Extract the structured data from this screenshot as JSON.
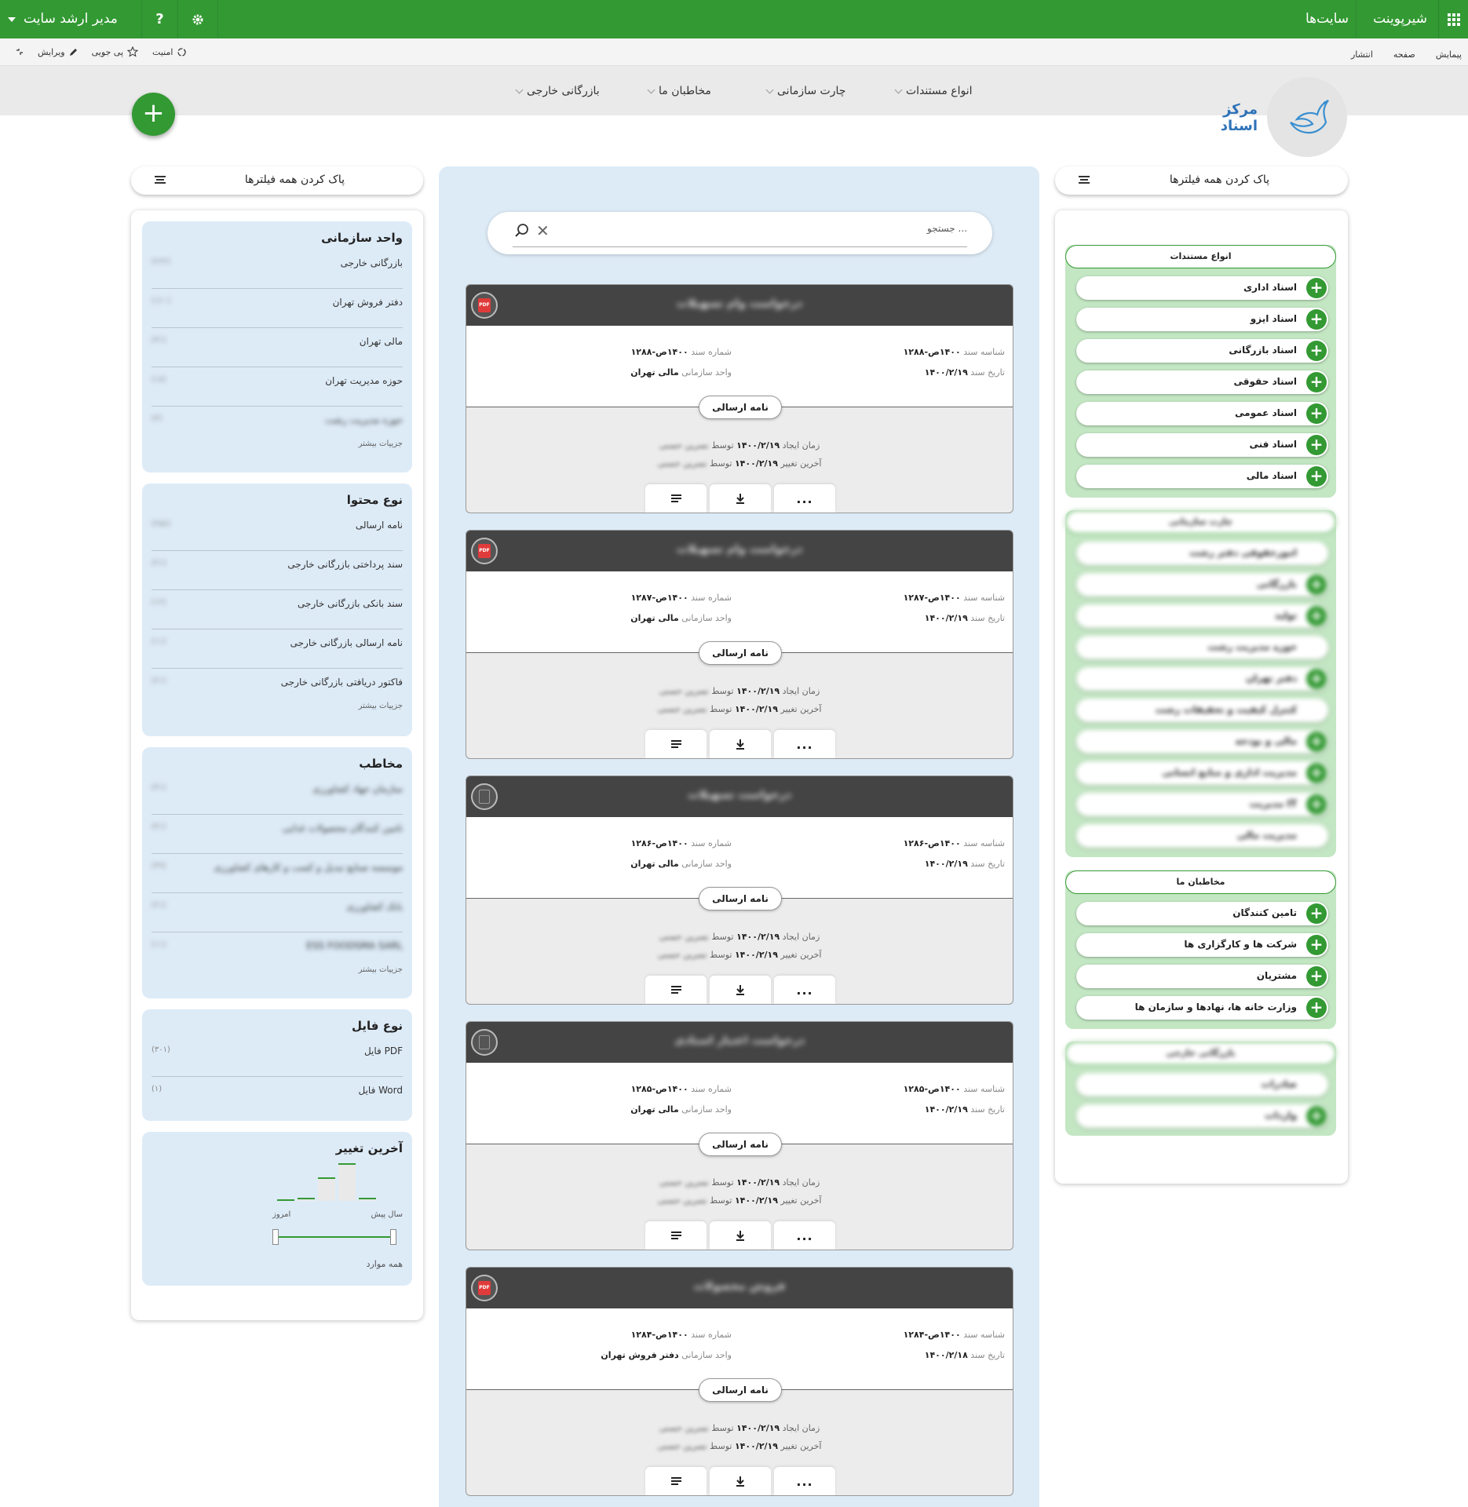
{
  "suite": {
    "brand": "شیرپوینت",
    "sites": "سایت‌ها",
    "user": "مدیر ارشد سایت",
    "help": "?"
  },
  "ribbon": {
    "tabs": [
      "پیمایش",
      "صفحه",
      "انتشار"
    ],
    "share": "امنیت",
    "follow": "پی جویی",
    "edit": "ویرایش"
  },
  "header": {
    "site_title": "مرکز اسناد",
    "nav": [
      "انواع مستندات",
      "چارت سازمانی",
      "مخاطبان ما",
      "بازرگانی خارجی"
    ],
    "fab": "+"
  },
  "clear_filters": "پاک کردن همه فیلترها",
  "search": {
    "placeholder": "جستجو ..."
  },
  "left_filters": {
    "org_unit": {
      "title": "واحد سازمانی",
      "items": [
        {
          "name": "بازرگانی خارجی",
          "count": "(۲۶۲)"
        },
        {
          "name": "دفتر فروش تهران",
          "count": "(۱۶۰)"
        },
        {
          "name": "مالی تهران",
          "count": "(۳۱)"
        },
        {
          "name": "حوزه مدیریت تهران",
          "count": "(۱۸)"
        },
        {
          "name": "حوزه مدیریت رشت",
          "count": "(۳)"
        }
      ],
      "more": "جزییات بیشتر"
    },
    "content_type": {
      "title": "نوع محتوا",
      "items": [
        {
          "name": "نامه ارسالی",
          "count": "(۲۵۸)"
        },
        {
          "name": "سند پرداختی بازرگانی خارجی",
          "count": "(۲۱)"
        },
        {
          "name": "سند بانکی بازرگانی خارجی",
          "count": "(۱۲)"
        },
        {
          "name": "نامه ارسالی بازرگانی خارجی",
          "count": "(۱۱)"
        },
        {
          "name": "فاکتور دریافتی بازرگانی خارجی",
          "count": "(۲۱)"
        }
      ],
      "more": "جزییات بیشتر"
    },
    "audience": {
      "title": "مخاطب",
      "items": [
        {
          "name": "سازمان جهاد کشاورزی",
          "count": "(۳۱)"
        },
        {
          "name": "تامین کنندگان محصولات غذایی",
          "count": "(۴۱)"
        },
        {
          "name": "موسسه صنایع تبدیل و کسب و کارهای کشاورزی",
          "count": "(۳۹)"
        },
        {
          "name": "بانک کشاورزی",
          "count": "(۲۱)"
        },
        {
          "name": "ESS FOODSMA SARL",
          "count": "(۱۱)"
        }
      ],
      "more": "جزییات بیشتر"
    },
    "file_type": {
      "title": "نوع فایل",
      "items": [
        {
          "name": "فایل PDF",
          "count": "(۳۰۱)"
        },
        {
          "name": "فایل Word",
          "count": "(۱)"
        }
      ]
    },
    "last_modified": {
      "title": "آخرین تغییر",
      "label_past": "سال پیش",
      "label_today": "امروز",
      "all": "همه موارد",
      "histogram": [
        0.05,
        0.08,
        0.62,
        1.0,
        0.08
      ]
    }
  },
  "cards": [
    {
      "title": "درخواست وام تسهیلات",
      "file": "pdf",
      "id_label": "شناسه سند",
      "id": "۱۴۰۰ص-۱۲۸۸",
      "num_label": "شماره سند",
      "num": "۱۴۰۰ص-۱۲۸۸",
      "date_label": "تاریخ سند",
      "date": "۱۴۰۰/۲/۱۹",
      "unit_label": "واحد سازمانی",
      "unit": "مالی تهران",
      "type": "نامه ارسالی",
      "created_label": "زمان ایجاد",
      "created": "۱۴۰۰/۲/۱۹",
      "by": "توسط",
      "creator": "نسرین حسنی",
      "modified_label": "آخرین تغییر",
      "modified": "۱۴۰۰/۲/۱۹",
      "by2": "توسط",
      "modifier": "نسرین حسنی"
    },
    {
      "title": "درخواست وام تسهیلات",
      "file": "pdf",
      "id_label": "شناسه سند",
      "id": "۱۴۰۰ص-۱۲۸۷",
      "num_label": "شماره سند",
      "num": "۱۴۰۰ص-۱۲۸۷",
      "date_label": "تاریخ سند",
      "date": "۱۴۰۰/۲/۱۹",
      "unit_label": "واحد سازمانی",
      "unit": "مالی تهران",
      "type": "نامه ارسالی",
      "created_label": "زمان ایجاد",
      "created": "۱۴۰۰/۲/۱۹",
      "by": "توسط",
      "creator": "نسرین حسنی",
      "modified_label": "آخرین تغییر",
      "modified": "۱۴۰۰/۲/۱۹",
      "by2": "توسط",
      "modifier": "نسرین حسنی"
    },
    {
      "title": "درخواست تسهیلات",
      "file": "doc",
      "id_label": "شناسه سند",
      "id": "۱۴۰۰ص-۱۲۸۶",
      "num_label": "شماره سند",
      "num": "۱۴۰۰ص-۱۲۸۶",
      "date_label": "تاریخ سند",
      "date": "۱۴۰۰/۲/۱۹",
      "unit_label": "واحد سازمانی",
      "unit": "مالی تهران",
      "type": "نامه ارسالی",
      "created_label": "زمان ایجاد",
      "created": "۱۴۰۰/۲/۱۹",
      "by": "توسط",
      "creator": "نسرین حسنی",
      "modified_label": "آخرین تغییر",
      "modified": "۱۴۰۰/۲/۱۹",
      "by2": "توسط",
      "modifier": "نسرین حسنی"
    },
    {
      "title": "درخواست اعتبار اسنادی",
      "file": "doc",
      "id_label": "شناسه سند",
      "id": "۱۴۰۰ص-۱۲۸۵",
      "num_label": "شماره سند",
      "num": "۱۴۰۰ص-۱۲۸۵",
      "date_label": "تاریخ سند",
      "date": "۱۴۰۰/۲/۱۹",
      "unit_label": "واحد سازمانی",
      "unit": "مالی تهران",
      "type": "نامه ارسالی",
      "created_label": "زمان ایجاد",
      "created": "۱۴۰۰/۲/۱۹",
      "by": "توسط",
      "creator": "نسرین حسنی",
      "modified_label": "آخرین تغییر",
      "modified": "۱۴۰۰/۲/۱۹",
      "by2": "توسط",
      "modifier": "نسرین حسنی"
    },
    {
      "title": "فروش محصولات",
      "file": "pdf",
      "id_label": "شناسه سند",
      "id": "۱۴۰۰ص-۱۲۸۴",
      "num_label": "شماره سند",
      "num": "۱۴۰۰ص-۱۲۸۴",
      "date_label": "تاریخ سند",
      "date": "۱۴۰۰/۲/۱۸",
      "unit_label": "واحد سازمانی",
      "unit": "دفتر فروش تهران",
      "type": "نامه ارسالی",
      "created_label": "زمان ایجاد",
      "created": "۱۴۰۰/۲/۱۹",
      "by": "توسط",
      "creator": "نسرین حسنی",
      "modified_label": "آخرین تغییر",
      "modified": "۱۴۰۰/۲/۱۹",
      "by2": "توسط",
      "modifier": "نسرین حسنی"
    }
  ],
  "right_filters": {
    "doc_types": {
      "title": "انواع مستندات",
      "items": [
        "اسناد اداری",
        "اسناد ایزو",
        "اسناد بازرگانی",
        "اسناد حقوقی",
        "اسناد عمومی",
        "اسناد فنی",
        "اسناد مالی"
      ]
    },
    "org_chart": {
      "title": "چارت سازمانی",
      "items": [
        "امورحقوقی دفتر رشت",
        "بازرگانی",
        "تولید",
        "حوزه مدیریت رشت",
        "دفتر تهران",
        "کنترل کیفیت و تحقیقات رشت",
        "مالی و بودجه",
        "مدیریت اداری و منابع انسانی",
        "مدیریت IT",
        "مدیریت مالی"
      ],
      "plus": [
        false,
        true,
        true,
        false,
        true,
        false,
        true,
        true,
        true,
        false
      ]
    },
    "audiences": {
      "title": "مخاطبان ما",
      "items": [
        "تامین کنندگان",
        "شرکت ها و کارگزاری ها",
        "مشتریان",
        "وزارت خانه ها، نهادها و سازمان ها"
      ]
    },
    "foreign": {
      "title": "بازرگانی خارجی",
      "items": [
        "صادرات",
        "واردات"
      ],
      "plus": [
        false,
        true
      ]
    }
  },
  "card_actions": {
    "details": "details-icon",
    "download": "download-icon",
    "more": "..."
  },
  "colors": {
    "brand": "#339933",
    "title_blue": "#2d72b8",
    "card_head": "#444444",
    "center_bg": "#ddebf7"
  }
}
